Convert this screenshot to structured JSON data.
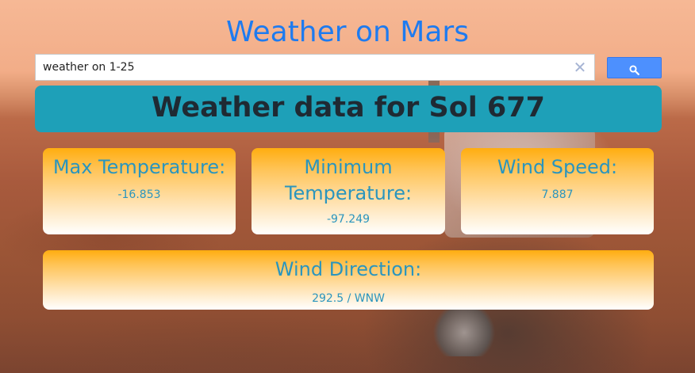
{
  "page": {
    "title": "Weather on Mars"
  },
  "search": {
    "value": "weather on 1-25",
    "clear_icon": "close-icon",
    "button_icon": "search-icon"
  },
  "banner": {
    "text": "Weather data for Sol 677"
  },
  "cards": {
    "max_temperature": {
      "label": "Max Temperature:",
      "value": "-16.853"
    },
    "min_temperature": {
      "label": "Minimum Temperature:",
      "value": "-97.249"
    },
    "wind_speed": {
      "label": "Wind Speed:",
      "value": "7.887"
    },
    "wind_direction": {
      "label": "Wind Direction:",
      "value": "292.5 / WNW"
    }
  },
  "colors": {
    "title": "#1e7bf0",
    "banner_bg": "#1ea0b8",
    "banner_text": "#1f2a33",
    "card_gradient_top": "#ffad10",
    "card_gradient_bottom": "#ffffff",
    "card_text": "#2a95be",
    "search_button": "#4d90fe"
  }
}
